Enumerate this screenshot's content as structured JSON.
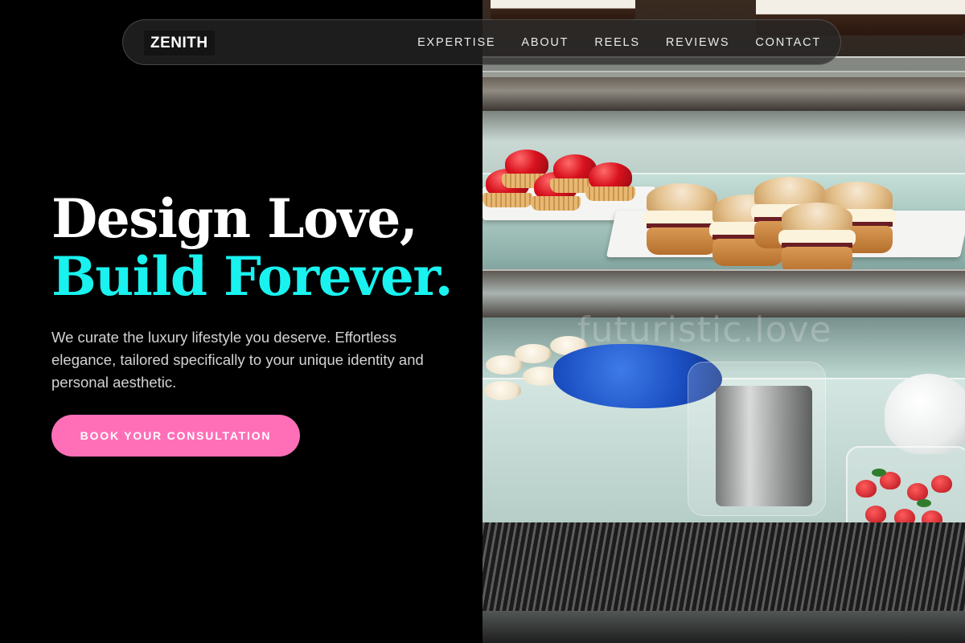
{
  "brand": {
    "logo_text": "ZENITH"
  },
  "nav": {
    "items": [
      {
        "label": "EXPERTISE"
      },
      {
        "label": "ABOUT"
      },
      {
        "label": "REELS"
      },
      {
        "label": "REVIEWS"
      },
      {
        "label": "CONTACT"
      }
    ]
  },
  "hero": {
    "headline_line1": "Design Love,",
    "headline_line2": "Build Forever.",
    "subtext": "We curate the luxury lifestyle you deserve. Effortless elegance, tailored specifically to your unique identity and personal aesthetic.",
    "cta_label": "BOOK YOUR CONSULTATION"
  },
  "media": {
    "watermark": "futuristic.love"
  },
  "colors": {
    "background": "#000000",
    "accent_cyan": "#19f2ef",
    "cta_pink": "#ff6fb8",
    "text_white": "#ffffff",
    "text_muted": "#d3d3d3"
  }
}
